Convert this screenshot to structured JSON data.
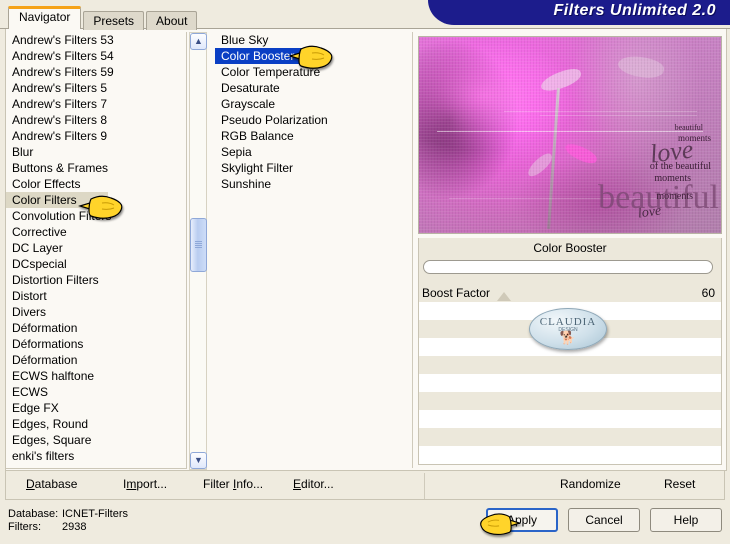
{
  "window": {
    "title": "Filters Unlimited 2.0"
  },
  "tabs": [
    {
      "label": "Navigator",
      "active": true
    },
    {
      "label": "Presets",
      "active": false
    },
    {
      "label": "About",
      "active": false
    }
  ],
  "categories": {
    "selected": "Color Filters",
    "items": [
      "Andrew's Filters 53",
      "Andrew's Filters 54",
      "Andrew's Filters 59",
      "Andrew's Filters 5",
      "Andrew's Filters 7",
      "Andrew's Filters 8",
      "Andrew's Filters 9",
      "Blur",
      "Buttons & Frames",
      "Color Effects",
      "Color Filters",
      "Convolution Filters",
      "Corrective",
      "DC Layer",
      "DCspecial",
      "Distortion Filters",
      "Distort",
      "Divers",
      "Déformation",
      "Déformations",
      "Déformation",
      "ECWS halftone",
      "ECWS",
      "Edge FX",
      "Edges, Round",
      "Edges, Square",
      "enki's filters"
    ]
  },
  "filters": {
    "selected": "Color Booster",
    "items": [
      "Blue Sky",
      "Color Booster",
      "Color Temperature",
      "Desaturate",
      "Grayscale",
      "Pseudo Polarization",
      "RGB Balance",
      "Sepia",
      "Skylight Filter",
      "Sunshine"
    ]
  },
  "preview": {
    "effect_title": "Color Booster",
    "preset_field_value": "",
    "preset_field_placeholder": "",
    "image_text": [
      "beautiful",
      "moments",
      "love",
      "of the beautiful",
      "moments",
      "beautiful",
      "moments",
      "love"
    ],
    "watermark": {
      "name": "CLAUDIA",
      "sub": "DESIGN"
    }
  },
  "parameters": [
    {
      "label": "Boost Factor",
      "value": "60"
    }
  ],
  "menu": [
    {
      "label": "Database",
      "accel": "D"
    },
    {
      "label": "Import...",
      "accel": "m"
    },
    {
      "label": "Filter Info...",
      "accel": "I"
    },
    {
      "label": "Editor...",
      "accel": "E"
    },
    {
      "label": "Randomize",
      "accel": ""
    },
    {
      "label": "Reset",
      "accel": ""
    }
  ],
  "status": {
    "database_key": "Database:",
    "database_value": "ICNET-Filters",
    "filters_key": "Filters:",
    "filters_value": "2938"
  },
  "buttons": {
    "apply": "Apply",
    "cancel": "Cancel",
    "help": "Help"
  },
  "colors": {
    "titlebar_blue": "#1c1c8c",
    "tab_accent_orange": "#f5a217",
    "selection_blue": "#0a3fc4",
    "category_highlight": "#ddd8c5",
    "panel_beige": "#efebdf",
    "focus_blue": "#2a64c8"
  },
  "scrollbar": {
    "up": "▲",
    "down": "▼",
    "position_percent": 48
  }
}
